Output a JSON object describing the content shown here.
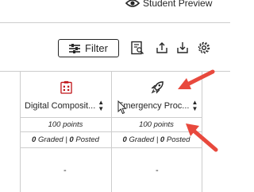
{
  "header": {
    "preview_label": "Student Preview"
  },
  "toolbar": {
    "filter_label": "Filter",
    "icons": [
      "report-icon",
      "upload-icon",
      "download-icon",
      "settings-icon"
    ]
  },
  "columns": [
    {
      "icon": "assignment-icon",
      "icon_color": "#c0161a",
      "title": "Digital Composit...",
      "points": "100 points",
      "graded_count": "0",
      "graded_label": "Graded",
      "posted_count": "0",
      "posted_label": "Posted",
      "cell_value": "-"
    },
    {
      "icon": "rocket-icon",
      "icon_color": "#262626",
      "title": "Emergency Proc...",
      "points": "100 points",
      "graded_count": "0",
      "graded_label": "Graded",
      "posted_count": "0",
      "posted_label": "Posted",
      "cell_value": "-"
    }
  ],
  "separator": "|",
  "colors": {
    "annotation_arrow": "#e8493d",
    "grid_line": "#cdcdcd",
    "text": "#262626"
  }
}
